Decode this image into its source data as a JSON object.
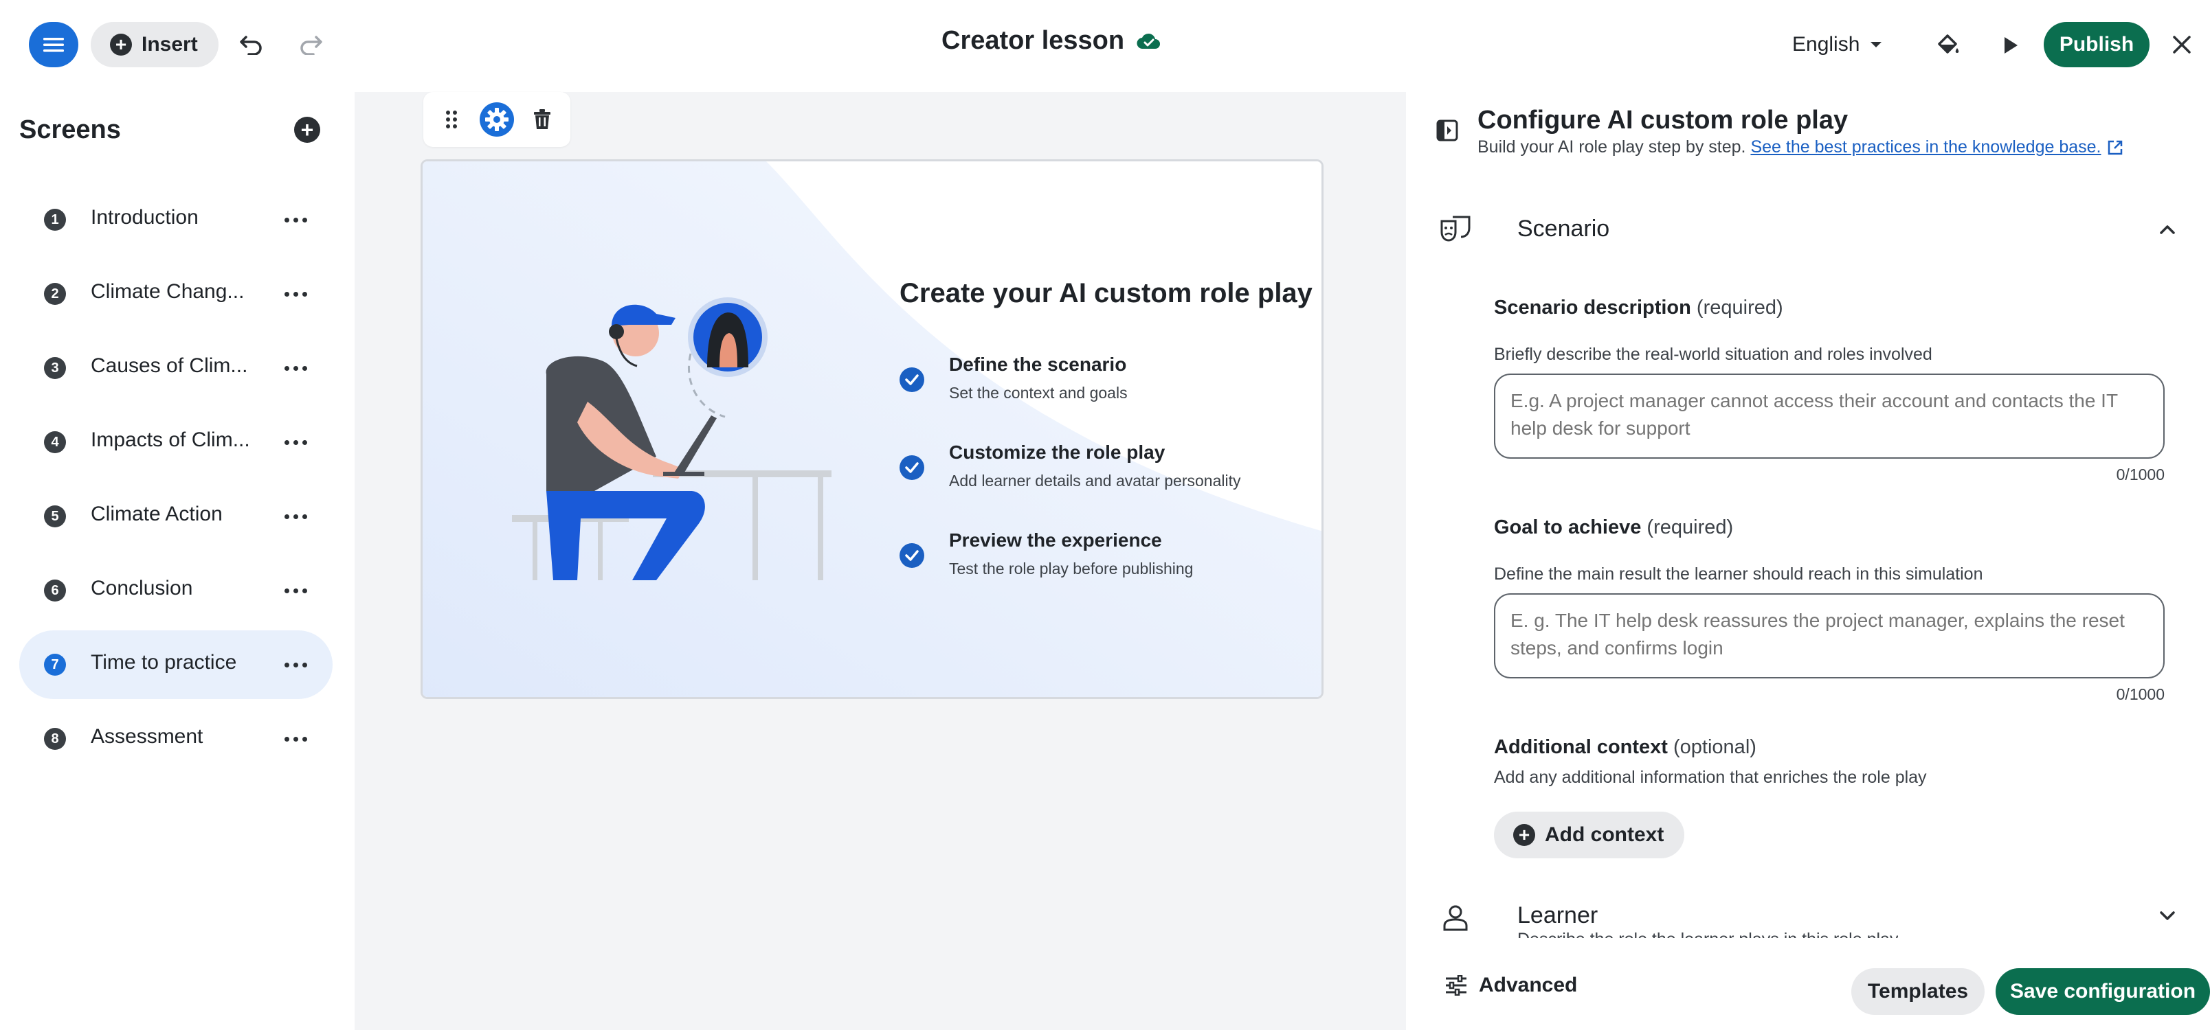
{
  "topbar": {
    "insert_label": "Insert",
    "title": "Creator lesson",
    "language": "English",
    "publish_label": "Publish"
  },
  "sidebar": {
    "title": "Screens",
    "items": [
      {
        "num": "1",
        "label": "Introduction"
      },
      {
        "num": "2",
        "label": "Climate Chang..."
      },
      {
        "num": "3",
        "label": "Causes of Clim..."
      },
      {
        "num": "4",
        "label": "Impacts of Clim..."
      },
      {
        "num": "5",
        "label": "Climate Action"
      },
      {
        "num": "6",
        "label": "Conclusion"
      },
      {
        "num": "7",
        "label": "Time to practice"
      },
      {
        "num": "8",
        "label": "Assessment"
      }
    ],
    "active_index": 6
  },
  "slide": {
    "heading": "Create your AI custom role play",
    "steps": [
      {
        "title": "Define the scenario",
        "sub": "Set the context and goals"
      },
      {
        "title": "Customize the role play",
        "sub": "Add learner details and avatar personality"
      },
      {
        "title": "Preview the experience",
        "sub": "Test the role play before publishing"
      }
    ]
  },
  "panel": {
    "title": "Configure AI custom role play",
    "subtitle": "Build your AI role play step by step.",
    "link_text": "See the best practices in the knowledge base.",
    "scenario": {
      "title": "Scenario",
      "description_label": "Scenario description",
      "description_required": "(required)",
      "description_help": "Briefly describe the real-world situation and roles involved",
      "description_placeholder": "E.g. A project manager cannot access their account and contacts the IT help desk for support",
      "description_counter": "0/1000",
      "goal_label": "Goal to achieve",
      "goal_required": "(required)",
      "goal_help": "Define the main result the learner should reach in this simulation",
      "goal_placeholder": "E. g. The IT help desk reassures the project manager, explains the reset steps, and confirms login",
      "goal_counter": "0/1000",
      "context_label": "Additional context",
      "context_optional": "(optional)",
      "context_help": "Add any additional information that enriches the role play",
      "add_context_label": "Add context"
    },
    "learner": {
      "title": "Learner",
      "sub": "Describe the role the learner plays in this role play"
    },
    "footer": {
      "advanced_label": "Advanced",
      "templates_label": "Templates",
      "save_label": "Save configuration"
    }
  },
  "colors": {
    "primary_blue": "#1a6ed8",
    "publish_green": "#0b6e4f",
    "active_item_bg": "#e8f0fc",
    "canvas_bg": "#f3f4f6"
  },
  "icons": [
    "menu-icon",
    "plus-icon",
    "undo-icon",
    "redo-icon",
    "cloud-check-icon",
    "chevron-down-icon",
    "paint-bucket-icon",
    "play-icon",
    "close-icon",
    "drag-handle-icon",
    "gear-icon",
    "trash-icon",
    "check-icon",
    "panel-collapse-icon",
    "external-link-icon",
    "theater-masks-icon",
    "chevron-up-icon",
    "person-icon",
    "sliders-icon",
    "more-dots-icon"
  ]
}
